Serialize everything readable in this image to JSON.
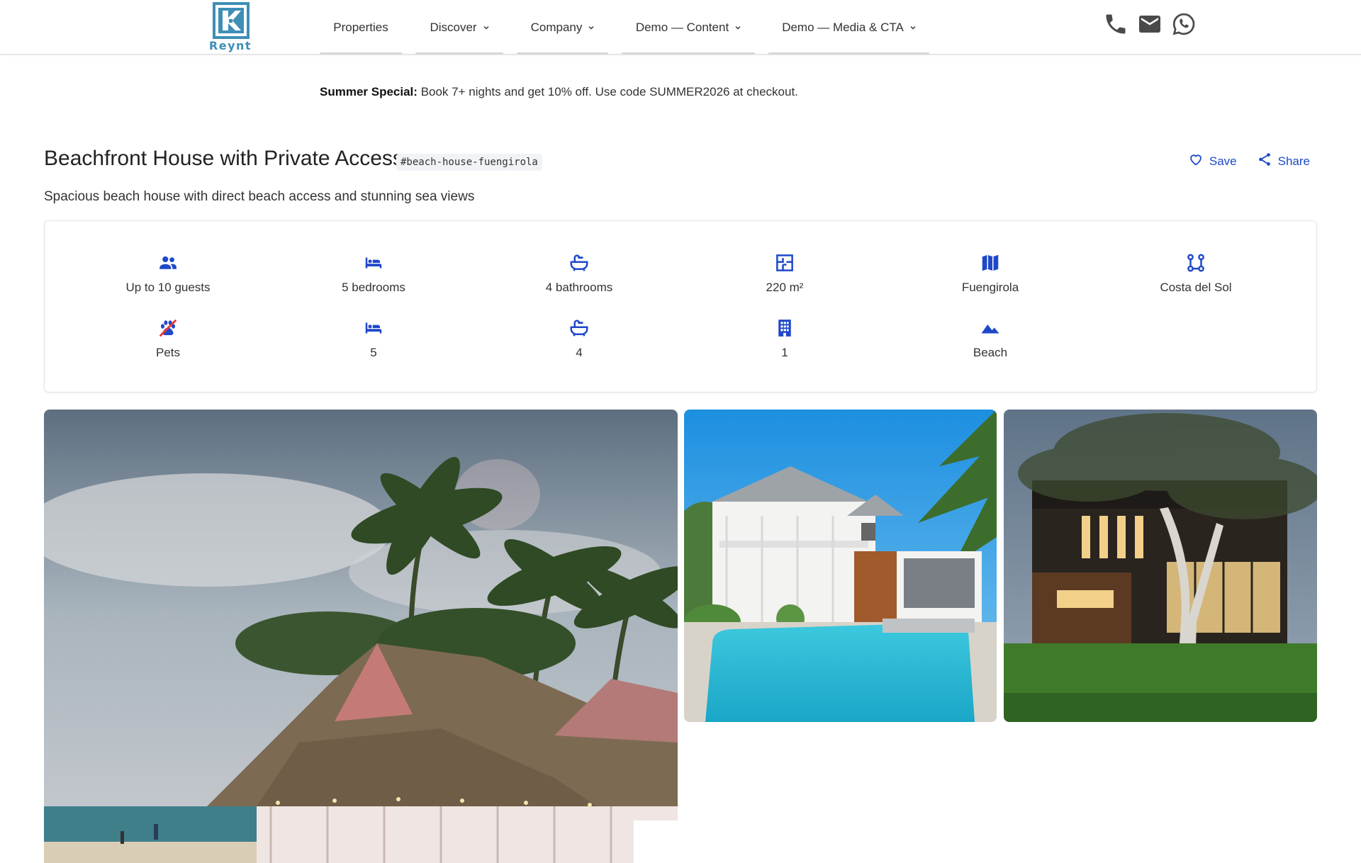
{
  "brand": {
    "name": "Reynt",
    "color": "#3d8fb5"
  },
  "nav": {
    "items": [
      {
        "label": "Properties",
        "has_dropdown": false
      },
      {
        "label": "Discover",
        "has_dropdown": true
      },
      {
        "label": "Company",
        "has_dropdown": true
      },
      {
        "label": "Demo — Content",
        "has_dropdown": true
      },
      {
        "label": "Demo — Media & CTA",
        "has_dropdown": true
      }
    ],
    "contact_icons": [
      "phone-icon",
      "mail-icon",
      "whatsapp-icon"
    ]
  },
  "promo": {
    "label": "Summer Special:",
    "text": "Book 7+ nights and get 10% off. Use code SUMMER2026 at checkout."
  },
  "property": {
    "title": "Beachfront House with Private Access",
    "slug": "#beach-house-fuengirola",
    "subtitle": "Spacious beach house with direct beach access and stunning sea views",
    "actions": {
      "save": "Save",
      "share": "Share"
    }
  },
  "facts": [
    {
      "icon": "guests-icon",
      "label": "Up to 10 guests"
    },
    {
      "icon": "bed-icon",
      "label": "5 bedrooms"
    },
    {
      "icon": "bathtub-icon",
      "label": "4 bathrooms"
    },
    {
      "icon": "floorplan-icon",
      "label": "220 m²"
    },
    {
      "icon": "map-icon",
      "label": "Fuengirola"
    },
    {
      "icon": "region-icon",
      "label": "Costa del Sol"
    },
    {
      "icon": "no-pets-icon",
      "label": "Pets"
    },
    {
      "icon": "bed-icon",
      "label": "5"
    },
    {
      "icon": "bathtub-icon",
      "label": "4"
    },
    {
      "icon": "building-icon",
      "label": "1"
    },
    {
      "icon": "landscape-icon",
      "label": "Beach"
    }
  ],
  "gallery": [
    "beach-resort-photo",
    "white-house-pool-photo",
    "modern-house-garden-photo"
  ],
  "colors": {
    "accent": "#1f48c9",
    "text": "#333333",
    "border": "#e4e4e4"
  }
}
